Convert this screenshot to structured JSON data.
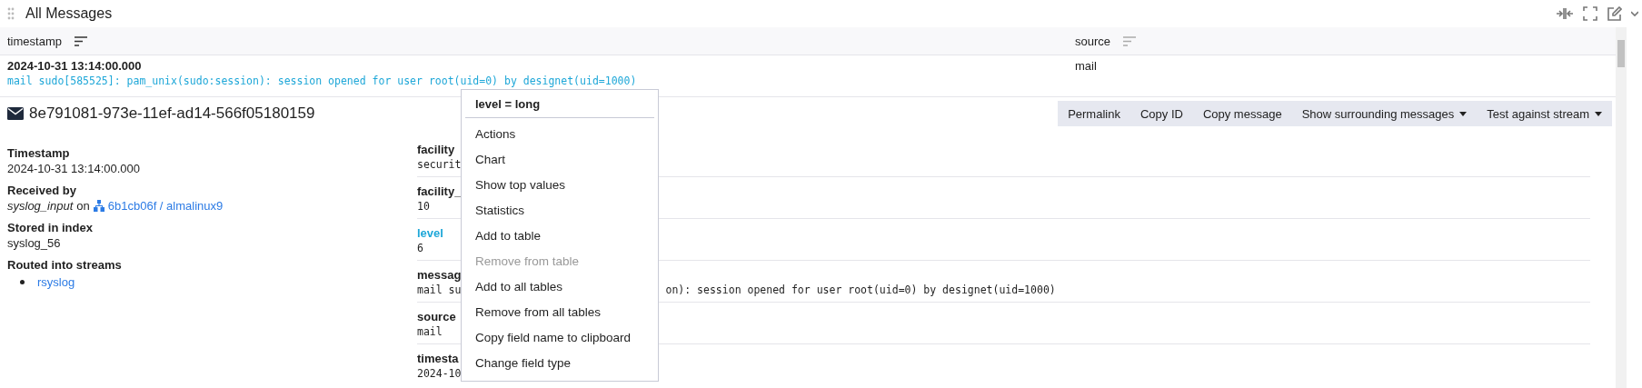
{
  "widget": {
    "title": "All Messages"
  },
  "table": {
    "columns": [
      {
        "label": "timestamp"
      },
      {
        "label": "source"
      }
    ],
    "rows": [
      {
        "timestamp": "2024-10-31 13:14:00.000",
        "source": "mail",
        "message": "mail sudo[585525]: pam_unix(sudo:session): session opened for user root(uid=0) by designet(uid=1000)"
      }
    ]
  },
  "detail": {
    "id": "8e791081-973e-11ef-ad14-566f05180159",
    "actions": [
      {
        "label": "Permalink",
        "dropdown": false
      },
      {
        "label": "Copy ID",
        "dropdown": false
      },
      {
        "label": "Copy message",
        "dropdown": false
      },
      {
        "label": "Show surrounding messages",
        "dropdown": true
      },
      {
        "label": "Test against stream",
        "dropdown": true
      }
    ],
    "timestamp_label": "Timestamp",
    "timestamp": "2024-10-31 13:14:00.000",
    "received_label": "Received by",
    "input": "syslog_input",
    "on": "on",
    "node": "6b1cb06f / almalinux9",
    "index_label": "Stored in index",
    "index": "syslog_56",
    "streams_label": "Routed into streams",
    "streams": [
      "rsyslog"
    ],
    "fields": [
      {
        "name": "facility",
        "value": "securit",
        "selected": false
      },
      {
        "name": "facility_",
        "value": "10",
        "selected": false
      },
      {
        "name": "level",
        "value": "6",
        "selected": true
      },
      {
        "name": "messag",
        "value": "mail su",
        "value_after": "on): session opened for user root(uid=0) by designet(uid=1000)",
        "selected": false
      },
      {
        "name": "source",
        "value": "mail",
        "selected": false
      },
      {
        "name": "timesta",
        "value": "2024-10",
        "selected": false
      }
    ]
  },
  "context_menu": {
    "title": "level = long",
    "items": [
      {
        "label": "Actions",
        "disabled": false
      },
      {
        "label": "Chart",
        "disabled": false
      },
      {
        "label": "Show top values",
        "disabled": false
      },
      {
        "label": "Statistics",
        "disabled": false
      },
      {
        "label": "Add to table",
        "disabled": false
      },
      {
        "label": "Remove from table",
        "disabled": true
      },
      {
        "label": "Add to all tables",
        "disabled": false
      },
      {
        "label": "Remove from all tables",
        "disabled": false
      },
      {
        "label": "Copy field name to clipboard",
        "disabled": false
      },
      {
        "label": "Change field type",
        "disabled": false
      }
    ]
  }
}
